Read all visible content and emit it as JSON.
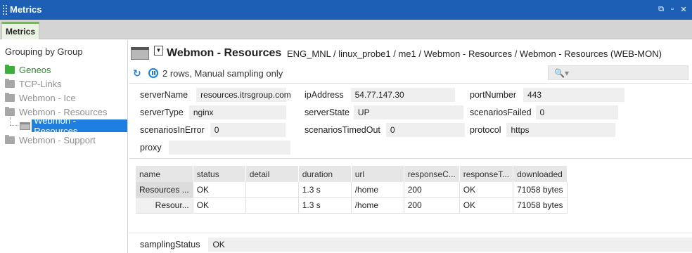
{
  "window": {
    "title": "Metrics",
    "controls": [
      "⧉",
      "▫",
      "✕"
    ]
  },
  "tabs": [
    {
      "label": "Metrics"
    }
  ],
  "sidebar": {
    "heading": "Grouping by Group",
    "items": [
      {
        "label": "Geneos",
        "color": "#3cae3c"
      },
      {
        "label": "TCP-Links",
        "color": "#a7a7a7"
      },
      {
        "label": "Webmon - Ice",
        "color": "#a7a7a7"
      },
      {
        "label": "Webmon - Resources",
        "color": "#a7a7a7"
      },
      {
        "label": "Webmon - Resources",
        "selected": true
      },
      {
        "label": "Webmon - Support",
        "color": "#a7a7a7"
      }
    ]
  },
  "header": {
    "title": "Webmon - Resources",
    "path": "ENG_MNL / linux_probe1 / me1 / Webmon - Resources / Webmon - Resources (WEB-MON)",
    "status": "2 rows, Manual sampling only",
    "search_icon": "🔍▾"
  },
  "headlines": {
    "serverName": {
      "label": "serverName",
      "value": "resources.itrsgroup.com"
    },
    "ipAddress": {
      "label": "ipAddress",
      "value": "54.77.147.30"
    },
    "portNumber": {
      "label": "portNumber",
      "value": "443"
    },
    "serverType": {
      "label": "serverType",
      "value": "nginx"
    },
    "serverState": {
      "label": "serverState",
      "value": "UP"
    },
    "scenariosFailed": {
      "label": "scenariosFailed",
      "value": "0"
    },
    "scenariosInError": {
      "label": "scenariosInError",
      "value": "0"
    },
    "scenariosTimedOut": {
      "label": "scenariosTimedOut",
      "value": "0"
    },
    "protocol": {
      "label": "protocol",
      "value": "https"
    },
    "proxy": {
      "label": "proxy",
      "value": ""
    }
  },
  "table": {
    "columns": [
      "name",
      "status",
      "detail",
      "duration",
      "url",
      "responseC...",
      "responseT...",
      "downloaded"
    ],
    "rows": [
      [
        "Resources ...",
        "OK",
        "",
        "1.3 s",
        "/home",
        "200",
        "OK",
        "71058 bytes"
      ],
      [
        "Resour...",
        "OK",
        "",
        "1.3 s",
        "/home",
        "200",
        "OK",
        "71058 bytes"
      ]
    ]
  },
  "footer": {
    "label": "samplingStatus",
    "value": "OK"
  },
  "colors": {
    "titlebar": "#1d5fb4",
    "selection": "#1e7fe0",
    "tab_accent": "#6cbf4a"
  }
}
